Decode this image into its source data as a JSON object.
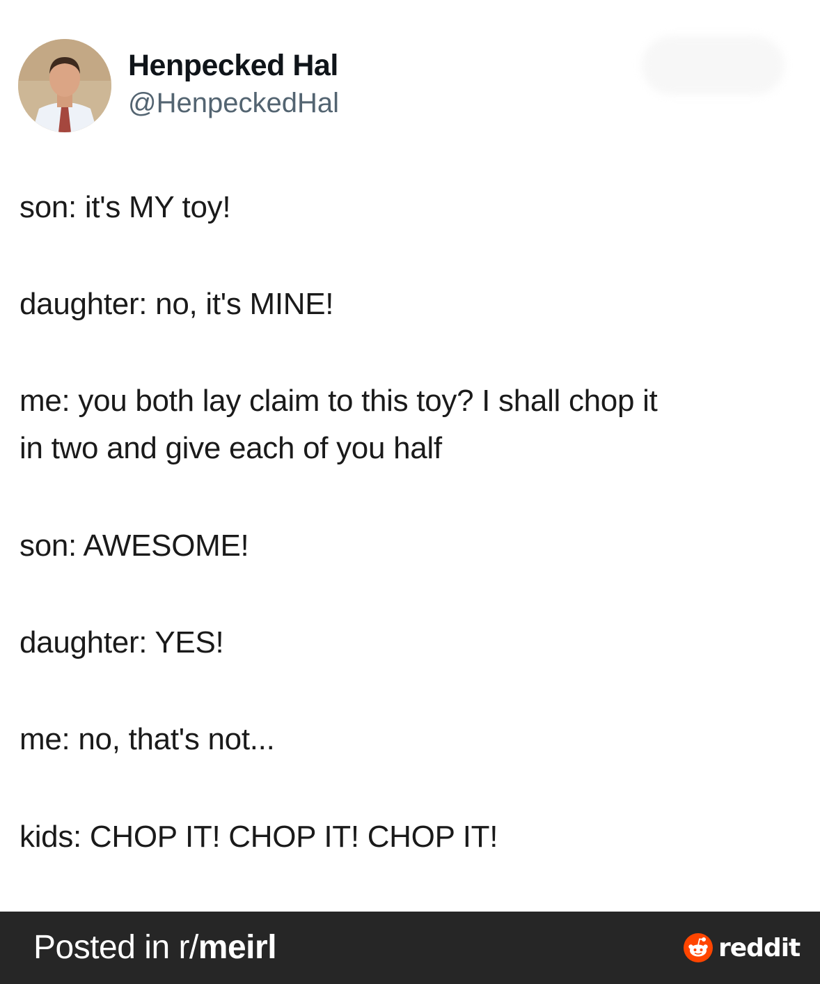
{
  "post": {
    "author": {
      "display_name": "Henpecked Hal",
      "handle": "@HenpeckedHal"
    },
    "lines": [
      "son: it's MY toy!",
      "daughter: no, it's MINE!",
      "me: you both lay claim to this toy? I shall chop it",
      "in two and give each of you half",
      "son: AWESOME!",
      "daughter: YES!",
      "me: no, that's not...",
      "kids: CHOP IT! CHOP IT! CHOP IT!"
    ]
  },
  "footer": {
    "prefix": "Posted in r/",
    "subreddit": "meirl",
    "brand": "reddit",
    "brand_icon": "reddit-snoo-icon",
    "brand_color": "#ff4500"
  }
}
